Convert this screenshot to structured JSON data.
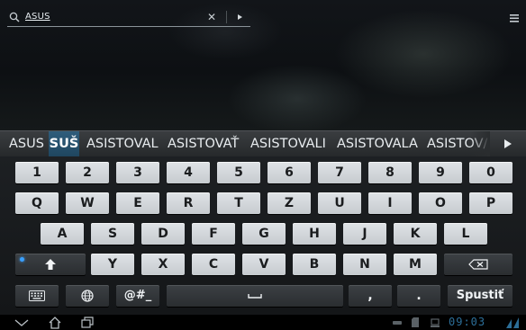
{
  "search": {
    "query": "ASUS"
  },
  "suggestions": {
    "items": [
      "ASUS",
      "SUŠ",
      "ASISTOVAL",
      "ASISTOVAŤ",
      "ASISTOVALI",
      "ASISTOVALA",
      "ASISTOV/"
    ],
    "selected_index": 1
  },
  "keyboard": {
    "row1": [
      "1",
      "2",
      "3",
      "4",
      "5",
      "6",
      "7",
      "8",
      "9",
      "0"
    ],
    "row2": [
      "Q",
      "W",
      "E",
      "R",
      "T",
      "Z",
      "U",
      "I",
      "O",
      "P"
    ],
    "row3": [
      "A",
      "S",
      "D",
      "F",
      "G",
      "H",
      "J",
      "K",
      "L"
    ],
    "row4": [
      "Y",
      "X",
      "C",
      "V",
      "B",
      "N",
      "M"
    ],
    "symbols_label": "@#_",
    "comma_label": ",",
    "period_label": ".",
    "action_label": "Spustiť"
  },
  "status": {
    "time": "09:03"
  },
  "colors": {
    "accent": "#3aa0ff",
    "selected_suggestion": "#2f5d7c",
    "clock": "#2c6e98"
  },
  "icons": [
    "search-icon",
    "clear-icon",
    "go-icon",
    "menu-icon",
    "more-suggestions-icon",
    "shift-icon",
    "backspace-icon",
    "keyboard-settings-icon",
    "globe-icon",
    "space-icon",
    "back-icon",
    "home-icon",
    "recent-apps-icon",
    "usb-icon",
    "sd-card-icon",
    "download-icon",
    "wifi-icon"
  ]
}
